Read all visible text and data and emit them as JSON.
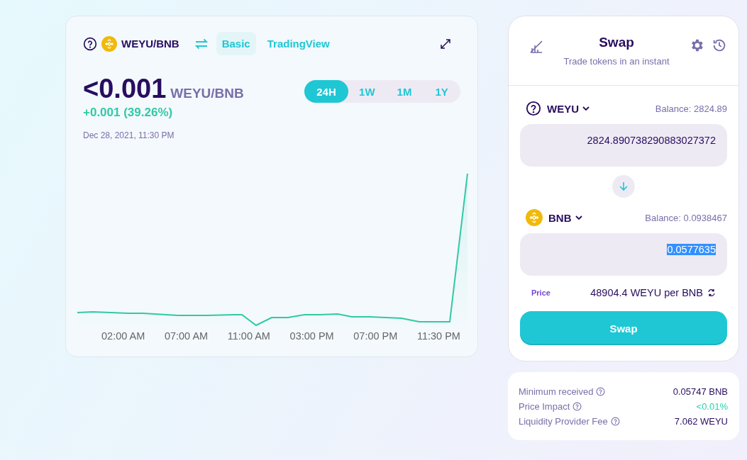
{
  "chart_header": {
    "pair": "WEYU/BNB",
    "tabs": [
      {
        "label": "Basic",
        "selected": true
      },
      {
        "label": "TradingView",
        "selected": false
      }
    ]
  },
  "price": {
    "value": "<0.001",
    "pair": "WEYU/BNB",
    "change": "+0.001 (39.26%)",
    "date": "Dec 28, 2021, 11:30 PM"
  },
  "ranges": [
    {
      "label": "24H",
      "selected": true
    },
    {
      "label": "1W",
      "selected": false
    },
    {
      "label": "1M",
      "selected": false
    },
    {
      "label": "1Y",
      "selected": false
    }
  ],
  "chart": {
    "x_labels": [
      "02:00 AM",
      "07:00 AM",
      "11:00 AM",
      "03:00 PM",
      "07:00 PM",
      "11:30 PM"
    ]
  },
  "swap": {
    "title": "Swap",
    "subtitle": "Trade tokens in an instant",
    "from": {
      "token": "WEYU",
      "kind": "unknown",
      "balance": "Balance: 2824.89",
      "value": "2824.890738290883027372",
      "highlighted": false
    },
    "to": {
      "token": "BNB",
      "kind": "bnb",
      "balance": "Balance: 0.0938467",
      "value": "0.0577635",
      "highlighted": true
    },
    "price_label": "Price",
    "price": "48904.4 WEYU per BNB",
    "button": "Swap"
  },
  "details": [
    {
      "label": "Minimum received",
      "value": "0.05747 BNB",
      "positive": false
    },
    {
      "label": "Price Impact",
      "value": "<0.01%",
      "positive": true
    },
    {
      "label": "Liquidity Provider Fee",
      "value": "7.062 WEYU",
      "positive": false
    }
  ]
}
